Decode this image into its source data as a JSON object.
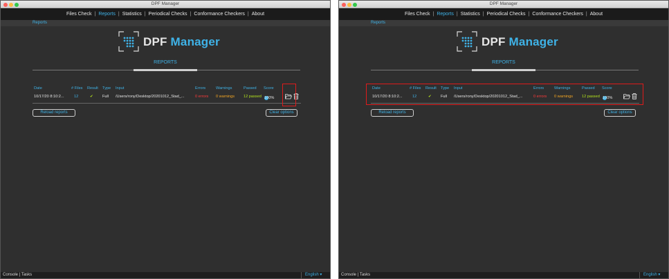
{
  "window": {
    "title": "DPF Manager"
  },
  "menu": [
    {
      "label": "Files Check",
      "active": false
    },
    {
      "label": "Reports",
      "active": true
    },
    {
      "label": "Statistics",
      "active": false
    },
    {
      "label": "Periodical Checks",
      "active": false
    },
    {
      "label": "Conformance Checkers",
      "active": false
    },
    {
      "label": "About",
      "active": false
    }
  ],
  "menu_separator": "|",
  "breadcrumb": "Reports",
  "logo": {
    "part1": "DPF",
    "part2": "Manager"
  },
  "section_title": "REPORTS",
  "table": {
    "headers": {
      "date": "Date",
      "files": "# Files",
      "result": "Result",
      "type": "Type",
      "input": "Input",
      "errors": "Errors",
      "warnings": "Warnings",
      "passed": "Passed",
      "score": "Score"
    },
    "row": {
      "date": "10/17/20 8:10:2...",
      "files": "12",
      "result": "✔",
      "type": "Full",
      "input": "/Users/rony/Desktop/20201012_Stad_...",
      "errors": "0 errors",
      "warnings": "0 warnings",
      "passed": "12 passed",
      "score": "100%"
    }
  },
  "buttons": {
    "reload": "Reload reports",
    "clear": "Clear options"
  },
  "status": {
    "console": "Console",
    "sep": "|",
    "tasks": "Tasks",
    "language": "English ▾"
  },
  "icons": {
    "folder": "folder-open-icon",
    "trash": "trash-icon"
  },
  "colors": {
    "accent": "#3fb3e8",
    "highlight": "#e01b1b",
    "error": "#ff3b3b",
    "warning": "#f5a623",
    "passed": "#b5e61d"
  }
}
